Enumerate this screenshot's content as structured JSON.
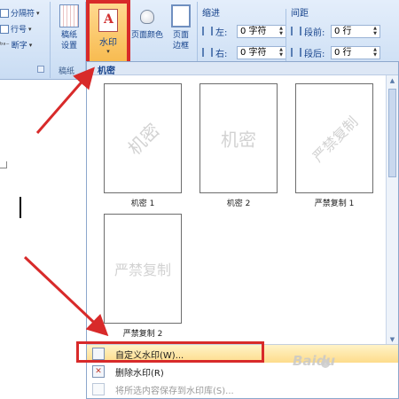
{
  "ribbon": {
    "left_column": {
      "break": "分隔符",
      "line_number": "行号",
      "hyphenation": "断字"
    },
    "manuscript_button": "稿纸\n设置",
    "manuscript_group": "稿纸",
    "watermark_button": "水印",
    "watermark_glyph": "A",
    "page_color_button": "页面颜色",
    "page_border_button": "页面\n边框",
    "indent": {
      "title": "缩进",
      "left_label": "左:",
      "left_value": "0 字符",
      "right_label": "右:",
      "right_value": "0 字符"
    },
    "spacing": {
      "title": "间距",
      "before_label": "段前:",
      "before_value": "0 行",
      "after_label": "段后:",
      "after_value": "0 行"
    }
  },
  "gallery": {
    "section_title": "机密",
    "items": [
      {
        "caption": "机密 1",
        "watermark": "机密"
      },
      {
        "caption": "机密 2",
        "watermark": "机密"
      },
      {
        "caption": "严禁复制 1",
        "watermark": "严禁复制"
      },
      {
        "caption": "严禁复制 2",
        "watermark": "严禁复制"
      }
    ]
  },
  "menu": {
    "custom_watermark": "自定义水印(W)...",
    "remove_watermark": "删除水印(R)",
    "save_to_gallery": "将所选内容保存到水印库(S)..."
  },
  "site_mark": "Baidu",
  "colors": {
    "annotation_red": "#d82a2a",
    "ribbon_blue": "#15428b",
    "hover_orange": "#f7b84a"
  }
}
